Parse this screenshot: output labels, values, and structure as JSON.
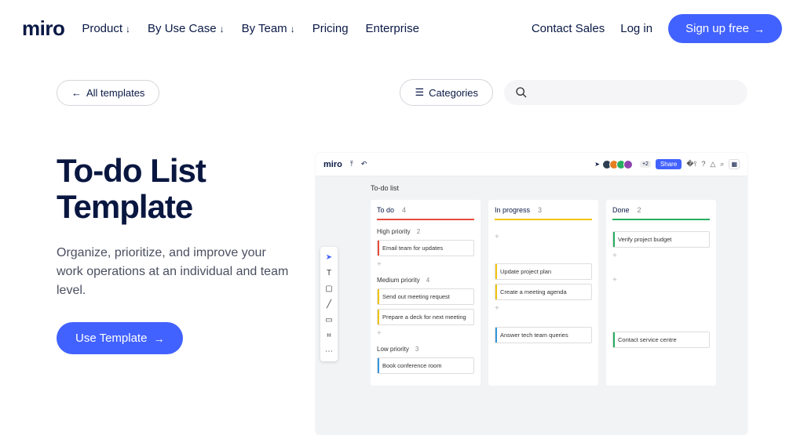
{
  "nav": {
    "logo": "miro",
    "items": [
      "Product",
      "By Use Case",
      "By Team",
      "Pricing",
      "Enterprise"
    ],
    "items_dropdown": [
      true,
      true,
      true,
      false,
      false
    ],
    "contact": "Contact Sales",
    "login": "Log in",
    "signup": "Sign up free"
  },
  "subbar": {
    "all_templates": "All templates",
    "categories": "Categories"
  },
  "hero": {
    "title": "To-do List Template",
    "subtitle": "Organize, prioritize, and improve your work operations at an individual and team level.",
    "button": "Use Template"
  },
  "preview": {
    "logo": "miro",
    "share": "Share",
    "plus_count": "+2",
    "board_title": "To-do list",
    "columns": [
      {
        "name": "To do",
        "count": "4",
        "color": "red"
      },
      {
        "name": "In progress",
        "count": "3",
        "color": "yellow"
      },
      {
        "name": "Done",
        "count": "2",
        "color": "green"
      }
    ],
    "sections": {
      "high": {
        "label": "High priority",
        "count": "2"
      },
      "medium": {
        "label": "Medium priority",
        "count": "4"
      },
      "low": {
        "label": "Low priority",
        "count": "3"
      }
    },
    "cards": {
      "todo_high": [
        "Email team for updates"
      ],
      "todo_med": [
        "Send out meeting request",
        "Prepare a deck for next meeting"
      ],
      "todo_low": [
        "Book conference room"
      ],
      "prog_med": [
        "Update project plan",
        "Create a meeting agenda"
      ],
      "prog_low": [
        "Answer tech team queries"
      ],
      "done_high": [
        "Verify project budget"
      ],
      "done_low": [
        "Contact service centre"
      ]
    },
    "avatar_colors": [
      "#2c3e50",
      "#e67e22",
      "#27ae60",
      "#8e44ad"
    ]
  }
}
